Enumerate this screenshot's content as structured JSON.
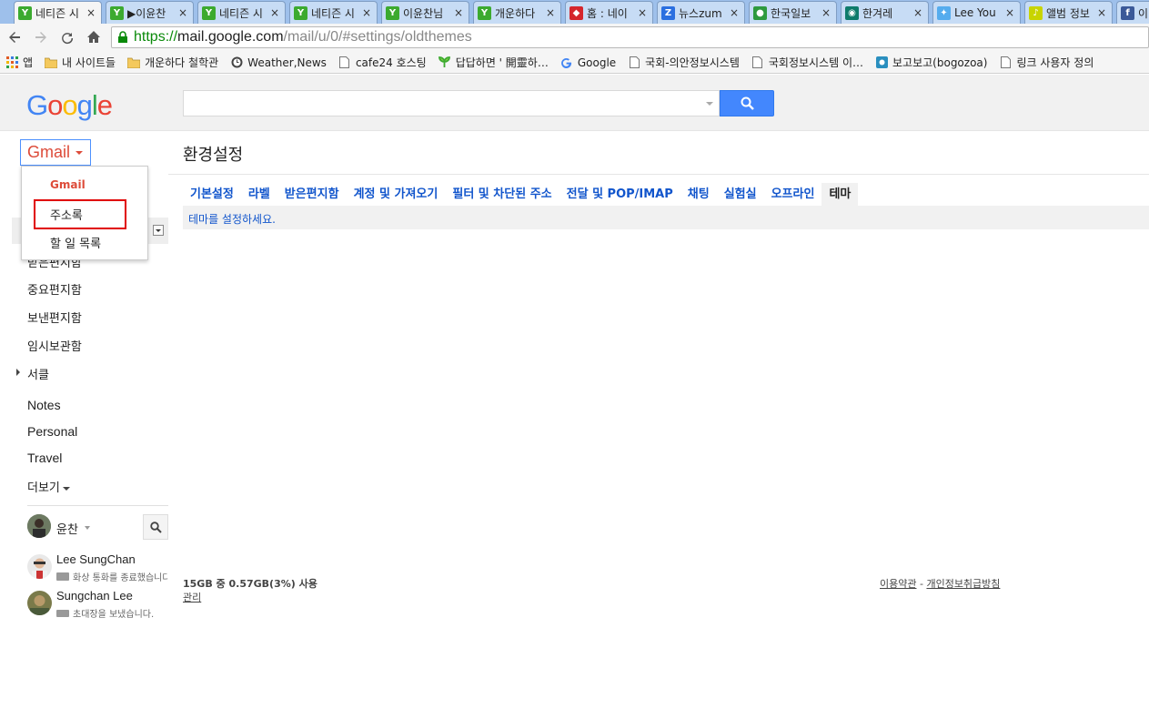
{
  "browser": {
    "tabs": [
      {
        "title": "네티즌 시",
        "icon": "sprout-icon",
        "color": "#3caa2f",
        "active": true
      },
      {
        "title": "▶이윤찬",
        "icon": "sprout-icon",
        "color": "#3caa2f"
      },
      {
        "title": "네티즌 시",
        "icon": "sprout-icon",
        "color": "#3caa2f"
      },
      {
        "title": "네티즌 시",
        "icon": "sprout-icon",
        "color": "#3caa2f"
      },
      {
        "title": "이윤찬님",
        "icon": "sprout-icon",
        "color": "#3caa2f"
      },
      {
        "title": "개운하다",
        "icon": "sprout-icon",
        "color": "#3caa2f"
      },
      {
        "title": "홈 : 네이",
        "icon": "naver-cube-icon",
        "color": "#d5262c"
      },
      {
        "title": "뉴스zum",
        "icon": "zum-z-icon",
        "color": "#2a6fe0"
      },
      {
        "title": "한국일보",
        "icon": "person-icon",
        "color": "#2e9a3e"
      },
      {
        "title": "한겨레",
        "icon": "hankyoreh-icon",
        "color": "#0e7b6b"
      },
      {
        "title": "Lee You",
        "icon": "twitter-bird-icon",
        "color": "#55acee"
      },
      {
        "title": "앨범 정보",
        "icon": "album-note-icon",
        "color": "#c8d400"
      },
      {
        "title": "이",
        "icon": "facebook-icon",
        "color": "#3b5998"
      }
    ],
    "close_glyph": "×",
    "url": {
      "scheme": "https://",
      "host": "mail.google.com",
      "path": "/mail/u/0/#settings/oldthemes"
    },
    "bookmarks": [
      {
        "label": "앱",
        "icon": "apps-grid-icon"
      },
      {
        "label": "내 사이트들",
        "icon": "folder-icon"
      },
      {
        "label": "개운하다 철학관",
        "icon": "folder-icon"
      },
      {
        "label": "Weather,News",
        "icon": "clock-icon"
      },
      {
        "label": "cafe24 호스팅",
        "icon": "page-icon"
      },
      {
        "label": "답답하면 ' 開靈하…",
        "icon": "sprout-icon"
      },
      {
        "label": "Google",
        "icon": "google-g-icon"
      },
      {
        "label": "국회-의안정보시스템",
        "icon": "page-icon"
      },
      {
        "label": "국회정보시스템 이…",
        "icon": "page-icon"
      },
      {
        "label": "보고보고(bogozoa)",
        "icon": "bogo-icon"
      },
      {
        "label": "링크 사용자 정의",
        "icon": "page-icon"
      }
    ]
  },
  "gmail": {
    "logo_letters": [
      {
        "char": "G",
        "color": "#4285f4"
      },
      {
        "char": "o",
        "color": "#ea4335"
      },
      {
        "char": "o",
        "color": "#fbbc05"
      },
      {
        "char": "g",
        "color": "#4285f4"
      },
      {
        "char": "l",
        "color": "#34a853"
      },
      {
        "char": "e",
        "color": "#ea4335"
      }
    ],
    "switcher_label": "Gmail",
    "switcher_menu": {
      "header": "Gmail",
      "items": [
        "주소록",
        "할 일 목록"
      ]
    },
    "nav": {
      "partial_inbox": "받은편지함",
      "items": [
        "중요편지함",
        "보낸편지함",
        "임시보관함",
        "서클"
      ],
      "labels": [
        "Notes",
        "Personal",
        "Travel"
      ],
      "more": "더보기"
    },
    "hangouts": {
      "me": "윤찬",
      "contacts": [
        {
          "name": "Lee SungChan",
          "status": "화상 통화를 종료했습니다."
        },
        {
          "name": "Sungchan Lee",
          "status": "초대장을 보냈습니다."
        }
      ]
    },
    "settings": {
      "title": "환경설정",
      "tabs": [
        "기본설정",
        "라벨",
        "받은편지함",
        "계정 및 가져오기",
        "필터 및 차단된 주소",
        "전달 및 POP/IMAP",
        "채팅",
        "실험실",
        "오프라인",
        "테마"
      ],
      "active_tab": "테마",
      "theme_message": "테마를 설정하세요."
    },
    "footer": {
      "storage": "15GB 중 0.57GB(3%) 사용",
      "manage": "관리",
      "terms": "이용약관",
      "separator": " - ",
      "privacy": "개인정보취급방침"
    }
  }
}
